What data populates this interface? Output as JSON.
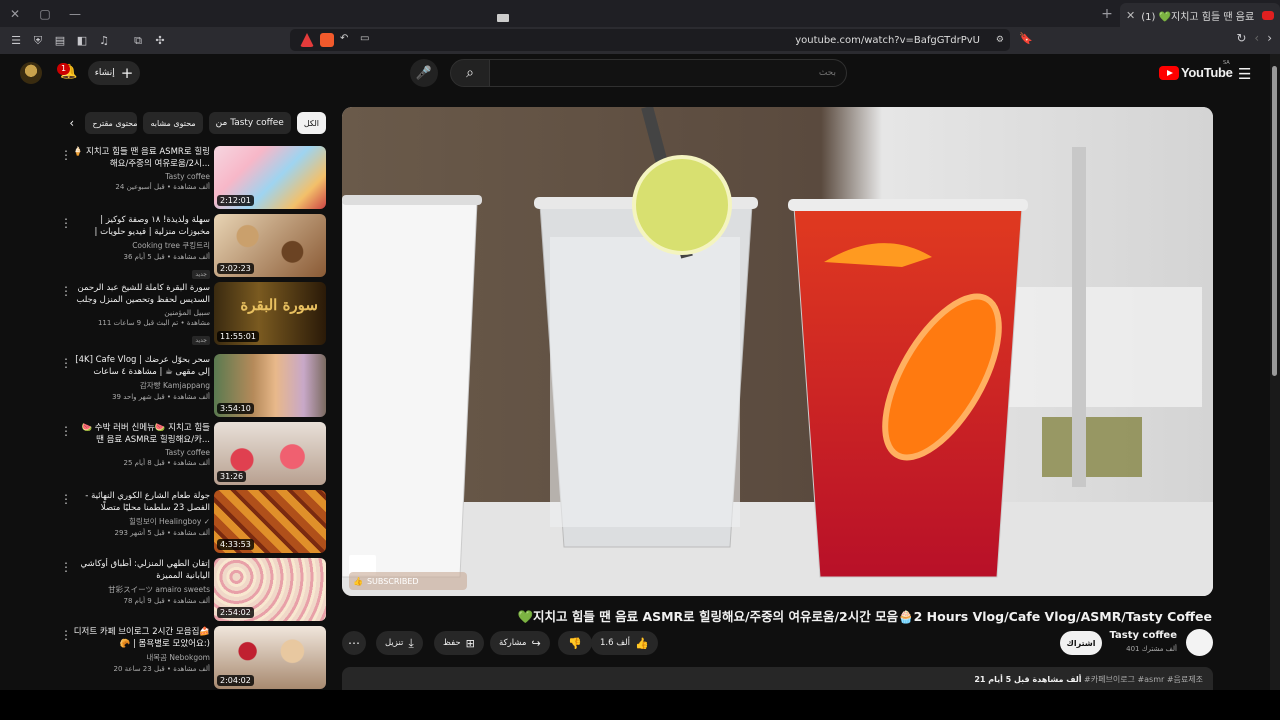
{
  "browser": {
    "tab_title": "(1) 💚지치고 힘들 땐 음료 AS",
    "url": "youtube.com/watch?v=BafgGTdrPvU"
  },
  "header": {
    "create_label": "إنشاء",
    "notif_count": "1",
    "search_placeholder": "بحث",
    "logo_text": "YouTube",
    "region": "SA"
  },
  "chips": [
    "الكل",
    "من Tasty coffee",
    "محتوى مشابه",
    "محتوى مقترح"
  ],
  "recommendations": [
    {
      "title": "🍦 지치고 힘들 땐 음료 ASMR로 힐링해요/주중의 여유로움/2시...",
      "channel": "Tasty coffee",
      "meta": "24 ألف مشاهدة • قبل أسبوعين",
      "duration": "2:12:01",
      "badge": ""
    },
    {
      "title": "سهلة ولذيذة! ١٨ وصفة كوكيز | مخبوزات منزلية | فيديو حلويات | شوكولاتة، ليمون، ...",
      "channel": "Cooking tree 쿠킹트리",
      "meta": "36 ألف مشاهدة • قبل 5 أيام",
      "duration": "2:02:23",
      "badge": "جديد"
    },
    {
      "title": "سورة البقرة كاملة للشيخ عبد الرحمن السديس لحفظ وتحصين المنزل وجلب البركة تلاوة ...",
      "channel": "سبيل المؤمنين",
      "meta": "111 مشاهدة • تم البث قبل 9 ساعات",
      "duration": "11:55:01",
      "badge": "جديد"
    },
    {
      "title": "[4K] Cafe Vlog | سحر بحوّل عرضك إلى مقهى ☕ | مشاهدة ٤ ساعات",
      "channel": "감자빵 Kamjappang",
      "meta": "39 ألف مشاهدة • قبل شهر واحد",
      "duration": "3:54:10",
      "badge": ""
    },
    {
      "title": "🍉 수박 러버 신메뉴🍉 지치고 힘들 땐 음료 ASMR로 힐링해요/카...",
      "channel": "Tasty coffee",
      "meta": "25 ألف مشاهدة • قبل 8 أيام",
      "duration": "31:26",
      "badge": ""
    },
    {
      "title": "جولة طعام الشارع الكوري النهائية - الفصل 23 سلطمنا محليًا متصلًا",
      "channel": "힐링보이 Healingboy ✓",
      "meta": "293 ألف مشاهدة • قبل 5 أشهر",
      "duration": "4:33:53",
      "badge": ""
    },
    {
      "title": "إتقان الطهي المنزلي: أطباق أوكاشي اليابانية المميزة",
      "channel": "甘彩スイーツ amairo sweets",
      "meta": "78 ألف مشاهدة • قبل 9 أيام",
      "duration": "2:54:02",
      "badge": ""
    },
    {
      "title": "디저트 카페 브이로그 2시간 모음집🍰🥐 | 몸욕별로 모았어요:)",
      "channel": "내복곰 Nebokgom",
      "meta": "20 ألف مشاهدة • قبل 23 ساعة",
      "duration": "2:04:02",
      "badge": ""
    }
  ],
  "video": {
    "title": "💚지치고 힘들 땐 음료 ASMR로 힐링해요/주중의 여유로움/2시간 모음🧁2 Hours Vlog/Cafe Vlog/ASMR/Tasty Coffee",
    "watermark": "SUBSCRIBED",
    "channel_name": "Tasty coffee",
    "channel_subs": "401 ألف مشترك",
    "subscribe_label": "اشتراك",
    "likes": "1.6 ألف",
    "share_label": "مشاركة",
    "save_label": "حفظ",
    "download_label": "تنزيل",
    "description_stats": "21 ألف مشاهدة قبل 5 أيام",
    "description_tags": "#카페브이로그 #asmr #음료제조"
  },
  "colors": {
    "accent": "#ff0000",
    "bg": "#0f0f0f",
    "chip": "#272727"
  }
}
